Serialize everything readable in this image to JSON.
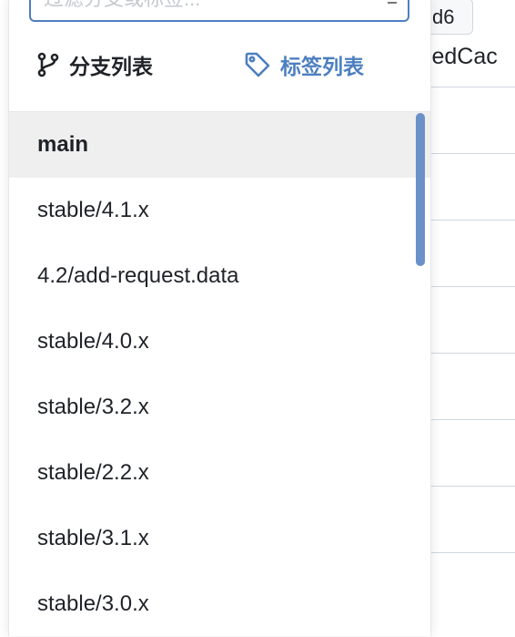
{
  "filter": {
    "placeholder": "过滤分支或标签..."
  },
  "tabs": {
    "branches_label": "分支列表",
    "tags_label": "标签列表",
    "active": "branches"
  },
  "branches": [
    {
      "name": "main",
      "selected": true
    },
    {
      "name": "stable/4.1.x"
    },
    {
      "name": "4.2/add-request.data"
    },
    {
      "name": "stable/4.0.x"
    },
    {
      "name": "stable/3.2.x"
    },
    {
      "name": "stable/2.2.x"
    },
    {
      "name": "stable/3.1.x"
    },
    {
      "name": "stable/3.0.x"
    }
  ],
  "background": {
    "chip_text": "d6",
    "text": "sedCac"
  },
  "colors": {
    "accent": "#4d7fc0",
    "selected_bg": "#efefef",
    "scrollbar": "#6b91c9"
  }
}
